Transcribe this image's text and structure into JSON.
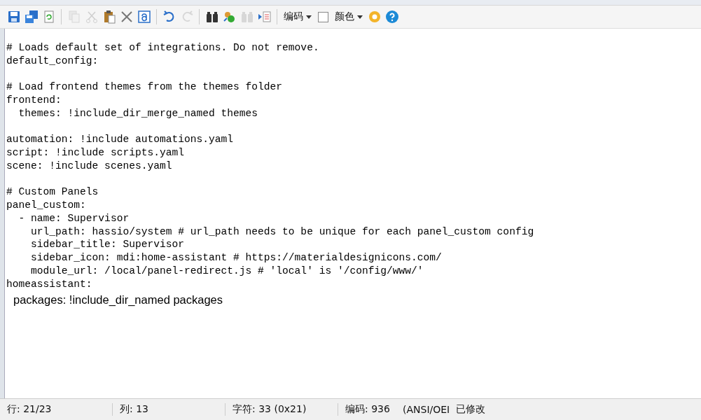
{
  "toolbar": [
    {
      "kind": "save",
      "disabled": false
    },
    {
      "kind": "save-all",
      "disabled": false
    },
    {
      "kind": "reload",
      "disabled": false
    },
    {
      "kind": "sep"
    },
    {
      "kind": "copy",
      "disabled": true
    },
    {
      "kind": "cut",
      "disabled": true
    },
    {
      "kind": "paste",
      "disabled": false
    },
    {
      "kind": "delete",
      "disabled": false
    },
    {
      "kind": "select-all",
      "disabled": false
    },
    {
      "kind": "sep"
    },
    {
      "kind": "undo",
      "disabled": false
    },
    {
      "kind": "redo",
      "disabled": true
    },
    {
      "kind": "sep"
    },
    {
      "kind": "find",
      "disabled": false
    },
    {
      "kind": "replace",
      "disabled": false
    },
    {
      "kind": "find-next",
      "disabled": true
    },
    {
      "kind": "goto",
      "disabled": false
    },
    {
      "kind": "sep"
    },
    {
      "kind": "menu",
      "label": "编码"
    },
    {
      "kind": "checkbox",
      "checked": false
    },
    {
      "kind": "menu",
      "label": "颜色"
    },
    {
      "kind": "gear",
      "disabled": false
    },
    {
      "kind": "help",
      "disabled": false
    }
  ],
  "editor": {
    "lines": [
      {
        "kind": "mono",
        "text": "# Loads default set of integrations. Do not remove."
      },
      {
        "kind": "mono",
        "text": "default_config:"
      },
      {
        "kind": "blank"
      },
      {
        "kind": "mono",
        "text": "# Load frontend themes from the themes folder"
      },
      {
        "kind": "mono",
        "text": "frontend:"
      },
      {
        "kind": "mono",
        "text": "  themes: !include_dir_merge_named themes"
      },
      {
        "kind": "blank"
      },
      {
        "kind": "mono",
        "text": "automation: !include automations.yaml"
      },
      {
        "kind": "mono",
        "text": "script: !include scripts.yaml"
      },
      {
        "kind": "mono",
        "text": "scene: !include scenes.yaml"
      },
      {
        "kind": "blank"
      },
      {
        "kind": "mono",
        "text": "# Custom Panels"
      },
      {
        "kind": "mono",
        "text": "panel_custom:"
      },
      {
        "kind": "mono",
        "text": "  - name: Supervisor"
      },
      {
        "kind": "mono",
        "text": "    url_path: hassio/system # url_path needs to be unique for each panel_custom config"
      },
      {
        "kind": "mono",
        "text": "    sidebar_title: Supervisor"
      },
      {
        "kind": "mono",
        "text": "    sidebar_icon: mdi:home-assistant # https://materialdesignicons.com/"
      },
      {
        "kind": "mono",
        "text": "    module_url: /local/panel-redirect.js # 'local' is '/config/www/'"
      },
      {
        "kind": "mono",
        "text": "homeassistant:"
      },
      {
        "kind": "proportional",
        "text": "packages: !include_dir_named packages"
      }
    ]
  },
  "status_bar": [
    "行: 21/23",
    "列: 13",
    "字符: 33 (0x21)",
    "编码: 936",
    "(ANSI/OEI",
    "已修改"
  ]
}
